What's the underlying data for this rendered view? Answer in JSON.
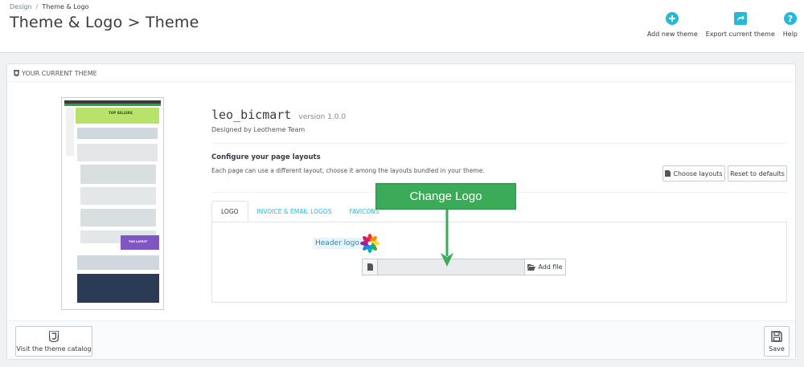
{
  "breadcrumb": {
    "parent": "Design",
    "separator": "/",
    "current": "Theme & Logo"
  },
  "page_title": "Theme & Logo > Theme",
  "toolbar": {
    "add_new_theme": "Add new theme",
    "export_current_theme": "Export current theme",
    "help": "Help"
  },
  "colors": {
    "accent": "#25b9d7",
    "callout": "#3aab58"
  },
  "panel": {
    "heading": "YOUR CURRENT THEME",
    "theme_name": "leo_bicmart",
    "theme_version": "version 1.0.0",
    "designed_by": "Designed by Leotheme Team",
    "configure_title": "Configure your page layouts",
    "configure_desc": "Each page can use a different layout, choose it among the layouts bundled in your theme.",
    "choose_layouts": "Choose layouts",
    "reset_defaults": "Reset to defaults",
    "tabs": [
      "LOGO",
      "INVOICE & EMAIL LOGOS",
      "FAVICONS"
    ],
    "header_logo_label": "Header logo",
    "add_file": "Add file",
    "file_value": ""
  },
  "preview": {
    "promo_text": "TOP SELLERS",
    "banner_text": "THE LATEST"
  },
  "callout": "Change Logo",
  "footer": {
    "visit_catalog": "Visit the theme catalog",
    "save": "Save"
  }
}
